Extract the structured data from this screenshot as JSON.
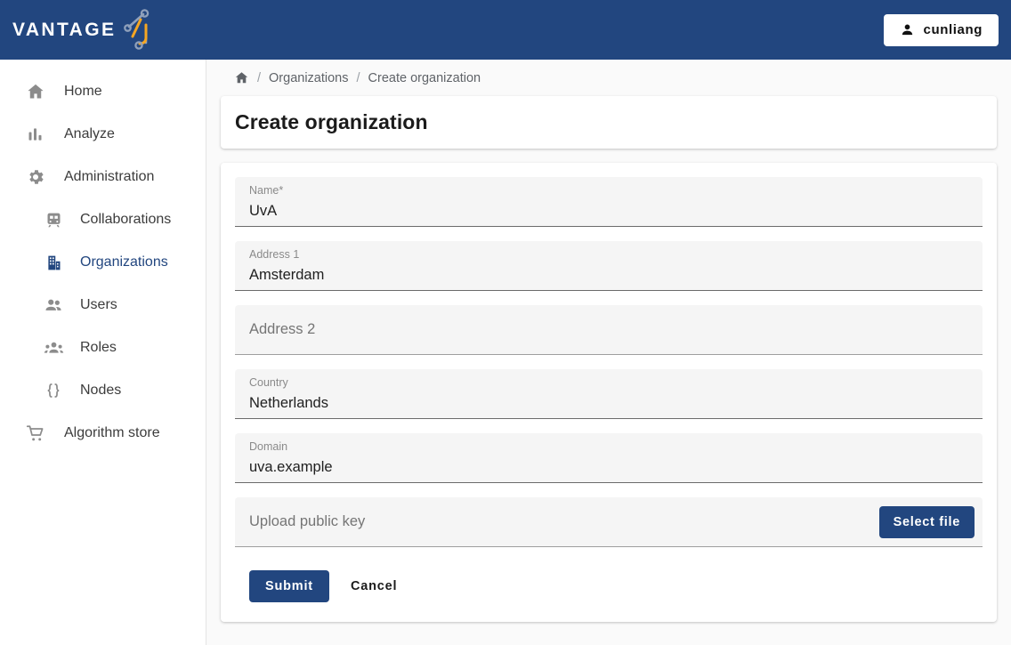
{
  "header": {
    "brand_word": "VANTAGE",
    "brand_mark_icon": "node-graph-logo-icon",
    "brand_colors": {
      "background": "#22467f",
      "accent_orange": "#f5a623",
      "accent_gray": "#8fa0bb"
    },
    "user_button": {
      "label": "cunliang",
      "icon": "person-icon"
    }
  },
  "sidebar": {
    "items": [
      {
        "label": "Home",
        "icon": "home-icon",
        "level": "top",
        "active": false
      },
      {
        "label": "Analyze",
        "icon": "bar-chart-icon",
        "level": "top",
        "active": false
      },
      {
        "label": "Administration",
        "icon": "gear-icon",
        "level": "top",
        "active": false
      },
      {
        "label": "Collaborations",
        "icon": "tram-icon",
        "level": "sub",
        "active": false
      },
      {
        "label": "Organizations",
        "icon": "building-icon",
        "level": "sub",
        "active": true
      },
      {
        "label": "Users",
        "icon": "people-icon",
        "level": "sub",
        "active": false
      },
      {
        "label": "Roles",
        "icon": "groups-icon",
        "level": "sub",
        "active": false
      },
      {
        "label": "Nodes",
        "icon": "curly-braces-icon",
        "level": "sub",
        "active": false
      },
      {
        "label": "Algorithm store",
        "icon": "shopping-cart-icon",
        "level": "top",
        "active": false
      }
    ]
  },
  "breadcrumb": {
    "home_icon": "home-icon",
    "separator": "/",
    "items": [
      "Organizations",
      "Create organization"
    ]
  },
  "page": {
    "title": "Create organization"
  },
  "form": {
    "fields": [
      {
        "label": "Name*",
        "value": "UvA",
        "placeholder": "",
        "filled": true
      },
      {
        "label": "Address 1",
        "value": "Amsterdam",
        "placeholder": "",
        "filled": true
      },
      {
        "label": "",
        "value": "",
        "placeholder": "Address 2",
        "filled": false
      },
      {
        "label": "Country",
        "value": "Netherlands",
        "placeholder": "",
        "filled": true
      },
      {
        "label": "Domain",
        "value": "uva.example",
        "placeholder": "",
        "filled": true
      }
    ],
    "upload": {
      "placeholder": "Upload public key",
      "button_label": "Select file"
    },
    "submit_label": "Submit",
    "cancel_label": "Cancel"
  }
}
